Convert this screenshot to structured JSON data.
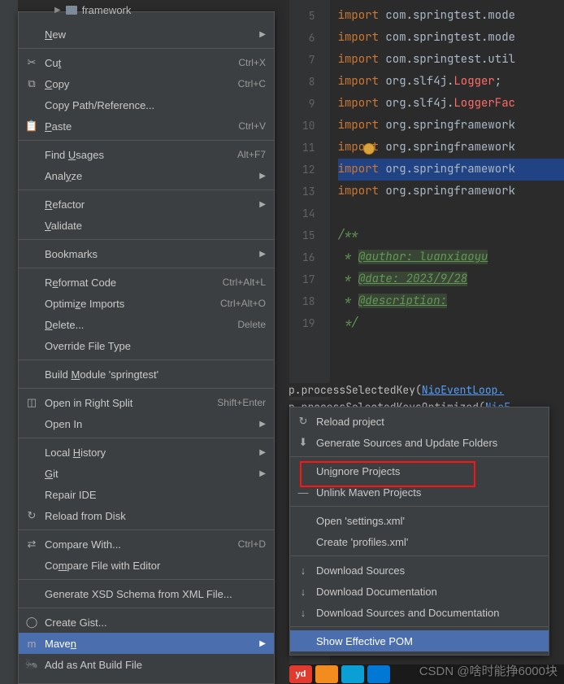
{
  "tree": {
    "framework": "framework"
  },
  "code": {
    "lines": [
      {
        "n": 5,
        "kw": "import",
        "rest": " com.springtest.mode"
      },
      {
        "n": 6,
        "kw": "import",
        "rest": " com.springtest.mode"
      },
      {
        "n": 7,
        "kw": "import",
        "rest": " com.springtest.util"
      },
      {
        "n": 8,
        "kw": "import",
        "rest": " org.slf4j.",
        "err": "Logger",
        "tail": ";"
      },
      {
        "n": 9,
        "kw": "import",
        "rest": " org.slf4j.",
        "err": "LoggerFac"
      },
      {
        "n": 10,
        "kw": "import",
        "rest": " org.springframework"
      },
      {
        "n": 11,
        "kw": "import",
        "rest": " org.springframework"
      },
      {
        "n": 12,
        "kw": "import",
        "rest": " org.springframework",
        "hl": true
      },
      {
        "n": 13,
        "kw": "import",
        "rest": " org.springframework"
      },
      {
        "n": 14
      },
      {
        "n": 15,
        "doc": "/**"
      },
      {
        "n": 16,
        "docpre": " * ",
        "docu": "@author: luanxiaoyu"
      },
      {
        "n": 17,
        "docpre": " * ",
        "docu": "@date: 2023/9/28"
      },
      {
        "n": 18,
        "docpre": " * ",
        "docu": "@description:"
      },
      {
        "n": 19,
        "doc": " */"
      }
    ]
  },
  "stack": {
    "s1_pre": "p.processSelectedKey(",
    "s1_link": "NioEventLoop.",
    "s2_pre": "p.processSelectedKeysOptimized(",
    "s2_link": "NioE"
  },
  "menu1": [
    {
      "type": "item",
      "label": "New",
      "arrow": true,
      "mn": 0
    },
    {
      "type": "sep"
    },
    {
      "type": "item",
      "label": "Cut",
      "shortcut": "Ctrl+X",
      "icon": "✂",
      "mn": 2
    },
    {
      "type": "item",
      "label": "Copy",
      "shortcut": "Ctrl+C",
      "icon": "⧉",
      "mn": 0
    },
    {
      "type": "item",
      "label": "Copy Path/Reference..."
    },
    {
      "type": "item",
      "label": "Paste",
      "shortcut": "Ctrl+V",
      "icon": "📋",
      "mn": 0
    },
    {
      "type": "sep"
    },
    {
      "type": "item",
      "label": "Find Usages",
      "shortcut": "Alt+F7",
      "mn": 5
    },
    {
      "type": "item",
      "label": "Analyze",
      "arrow": true,
      "mn": 4
    },
    {
      "type": "sep"
    },
    {
      "type": "item",
      "label": "Refactor",
      "arrow": true,
      "mn": 0
    },
    {
      "type": "item",
      "label": "Validate",
      "mn": 0
    },
    {
      "type": "sep"
    },
    {
      "type": "item",
      "label": "Bookmarks",
      "arrow": true
    },
    {
      "type": "sep"
    },
    {
      "type": "item",
      "label": "Reformat Code",
      "shortcut": "Ctrl+Alt+L",
      "mn": 1
    },
    {
      "type": "item",
      "label": "Optimize Imports",
      "shortcut": "Ctrl+Alt+O",
      "mn": 6
    },
    {
      "type": "item",
      "label": "Delete...",
      "shortcut": "Delete",
      "mn": 0
    },
    {
      "type": "item",
      "label": "Override File Type"
    },
    {
      "type": "sep"
    },
    {
      "type": "item",
      "label": "Build Module 'springtest'",
      "mn": 6
    },
    {
      "type": "sep"
    },
    {
      "type": "item",
      "label": "Open in Right Split",
      "shortcut": "Shift+Enter",
      "icon": "◫"
    },
    {
      "type": "item",
      "label": "Open In",
      "arrow": true
    },
    {
      "type": "sep"
    },
    {
      "type": "item",
      "label": "Local History",
      "arrow": true,
      "mn": 6
    },
    {
      "type": "item",
      "label": "Git",
      "arrow": true,
      "mn": 0
    },
    {
      "type": "item",
      "label": "Repair IDE"
    },
    {
      "type": "item",
      "label": "Reload from Disk",
      "icon": "↻"
    },
    {
      "type": "sep"
    },
    {
      "type": "item",
      "label": "Compare With...",
      "shortcut": "Ctrl+D",
      "icon": "⇄"
    },
    {
      "type": "item",
      "label": "Compare File with Editor",
      "mn": 2
    },
    {
      "type": "sep"
    },
    {
      "type": "item",
      "label": "Generate XSD Schema from XML File..."
    },
    {
      "type": "sep"
    },
    {
      "type": "item",
      "label": "Create Gist...",
      "icon": "◯"
    },
    {
      "type": "item",
      "label": "Maven",
      "arrow": true,
      "icon": "m",
      "selected": true,
      "mn": 4
    },
    {
      "type": "item",
      "label": "Add as Ant Build File",
      "icon": "🐜"
    }
  ],
  "menu2": [
    {
      "type": "item",
      "label": "Reload project",
      "icon": "↻"
    },
    {
      "type": "item",
      "label": "Generate Sources and Update Folders",
      "icon": "⬇"
    },
    {
      "type": "sep"
    },
    {
      "type": "item",
      "label": "Unignore Projects",
      "mn": 2
    },
    {
      "type": "item",
      "label": "Unlink Maven Projects",
      "icon": "—"
    },
    {
      "type": "sep"
    },
    {
      "type": "item",
      "label": "Open 'settings.xml'"
    },
    {
      "type": "item",
      "label": "Create 'profiles.xml'"
    },
    {
      "type": "sep"
    },
    {
      "type": "item",
      "label": "Download Sources",
      "icon": "↓"
    },
    {
      "type": "item",
      "label": "Download Documentation",
      "icon": "↓"
    },
    {
      "type": "item",
      "label": "Download Sources and Documentation",
      "icon": "↓"
    },
    {
      "type": "sep"
    },
    {
      "type": "item",
      "label": "Show Effective POM",
      "selected": true
    }
  ],
  "watermark": "CSDN @啥时能挣6000块",
  "taskbar": {
    "yd": "yd"
  }
}
